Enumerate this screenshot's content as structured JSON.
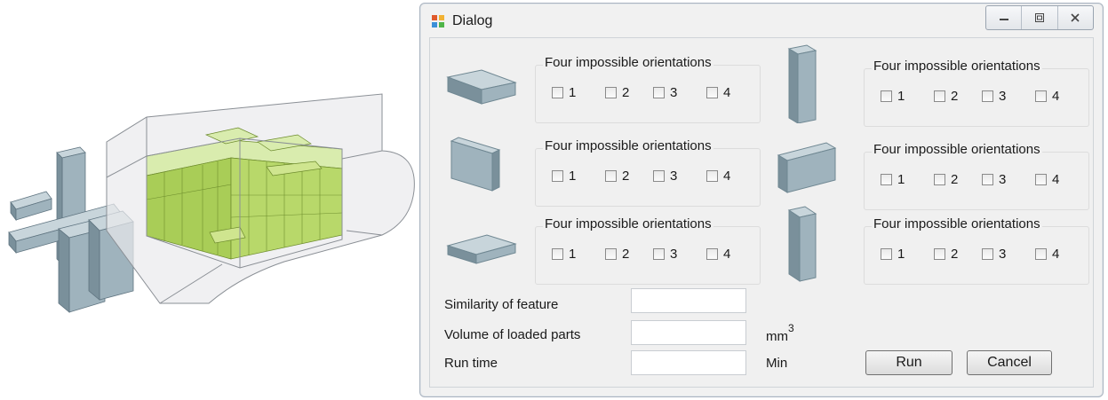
{
  "window": {
    "title": "Dialog"
  },
  "orientation_groups": [
    {
      "title": "Four impossible orientations",
      "options": [
        "1",
        "2",
        "3",
        "4"
      ]
    },
    {
      "title": "Four impossible orientations",
      "options": [
        "1",
        "2",
        "3",
        "4"
      ]
    },
    {
      "title": "Four impossible orientations",
      "options": [
        "1",
        "2",
        "3",
        "4"
      ]
    },
    {
      "title": "Four impossible orientations",
      "options": [
        "1",
        "2",
        "3",
        "4"
      ]
    },
    {
      "title": "Four impossible orientations",
      "options": [
        "1",
        "2",
        "3",
        "4"
      ]
    },
    {
      "title": "Four impossible orientations",
      "options": [
        "1",
        "2",
        "3",
        "4"
      ]
    }
  ],
  "fields": {
    "similarity_label": "Similarity of feature",
    "volume_label": "Volume of loaded parts",
    "volume_unit": "mm",
    "volume_unit_exp": "3",
    "runtime_label": "Run time",
    "runtime_unit": "Min",
    "similarity_value": "",
    "volume_value": "",
    "runtime_value": ""
  },
  "buttons": {
    "run": "Run",
    "cancel": "Cancel"
  },
  "colors": {
    "box_face": "#9fb3bd",
    "box_top": "#c9d6dc",
    "box_side": "#6f8792",
    "loaded_parts": "#b8d86a"
  }
}
